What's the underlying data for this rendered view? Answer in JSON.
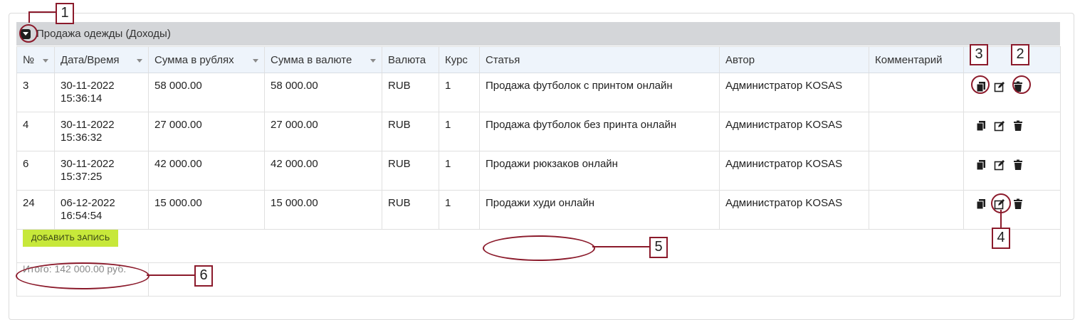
{
  "group": {
    "title": "Продажа одежды (Доходы)"
  },
  "columns": [
    "№",
    "Дата/Время",
    "Сумма в рублях",
    "Сумма в валюте",
    "Валюта",
    "Курс",
    "Статья",
    "Автор",
    "Комментарий"
  ],
  "rows": [
    {
      "num": "3",
      "date": "30-11-2022",
      "time": "15:36:14",
      "rub": "58 000.00",
      "cur_amount": "58 000.00",
      "currency": "RUB",
      "rate": "1",
      "article": "Продажа футболок с принтом онлайн",
      "author": "Администратор KOSAS",
      "comment": ""
    },
    {
      "num": "4",
      "date": "30-11-2022",
      "time": "15:36:32",
      "rub": "27 000.00",
      "cur_amount": "27 000.00",
      "currency": "RUB",
      "rate": "1",
      "article": "Продажа футболок без принта онлайн",
      "author": "Администратор KOSAS",
      "comment": ""
    },
    {
      "num": "6",
      "date": "30-11-2022",
      "time": "15:37:25",
      "rub": "42 000.00",
      "cur_amount": "42 000.00",
      "currency": "RUB",
      "rate": "1",
      "article": "Продажи рюкзаков онлайн",
      "author": "Администратор KOSAS",
      "comment": ""
    },
    {
      "num": "24",
      "date": "06-12-2022",
      "time": "16:54:54",
      "rub": "15 000.00",
      "cur_amount": "15 000.00",
      "currency": "RUB",
      "rate": "1",
      "article": "Продажи худи онлайн",
      "author": "Администратор KOSAS",
      "comment": ""
    }
  ],
  "add_button": "ДОБАВИТЬ ЗАПИСЬ",
  "total": "Итого: 142 000.00 руб.",
  "annotations": [
    "1",
    "2",
    "3",
    "4",
    "5",
    "6"
  ],
  "colors": {
    "header_bg": "#d4d6d9",
    "thead_bg": "#eef4fb",
    "add_button": "#c7e83a",
    "annotation": "#8b1a2b"
  },
  "icons": [
    "copy-icon",
    "edit-icon",
    "trash-icon",
    "toggle-collapse-icon"
  ]
}
